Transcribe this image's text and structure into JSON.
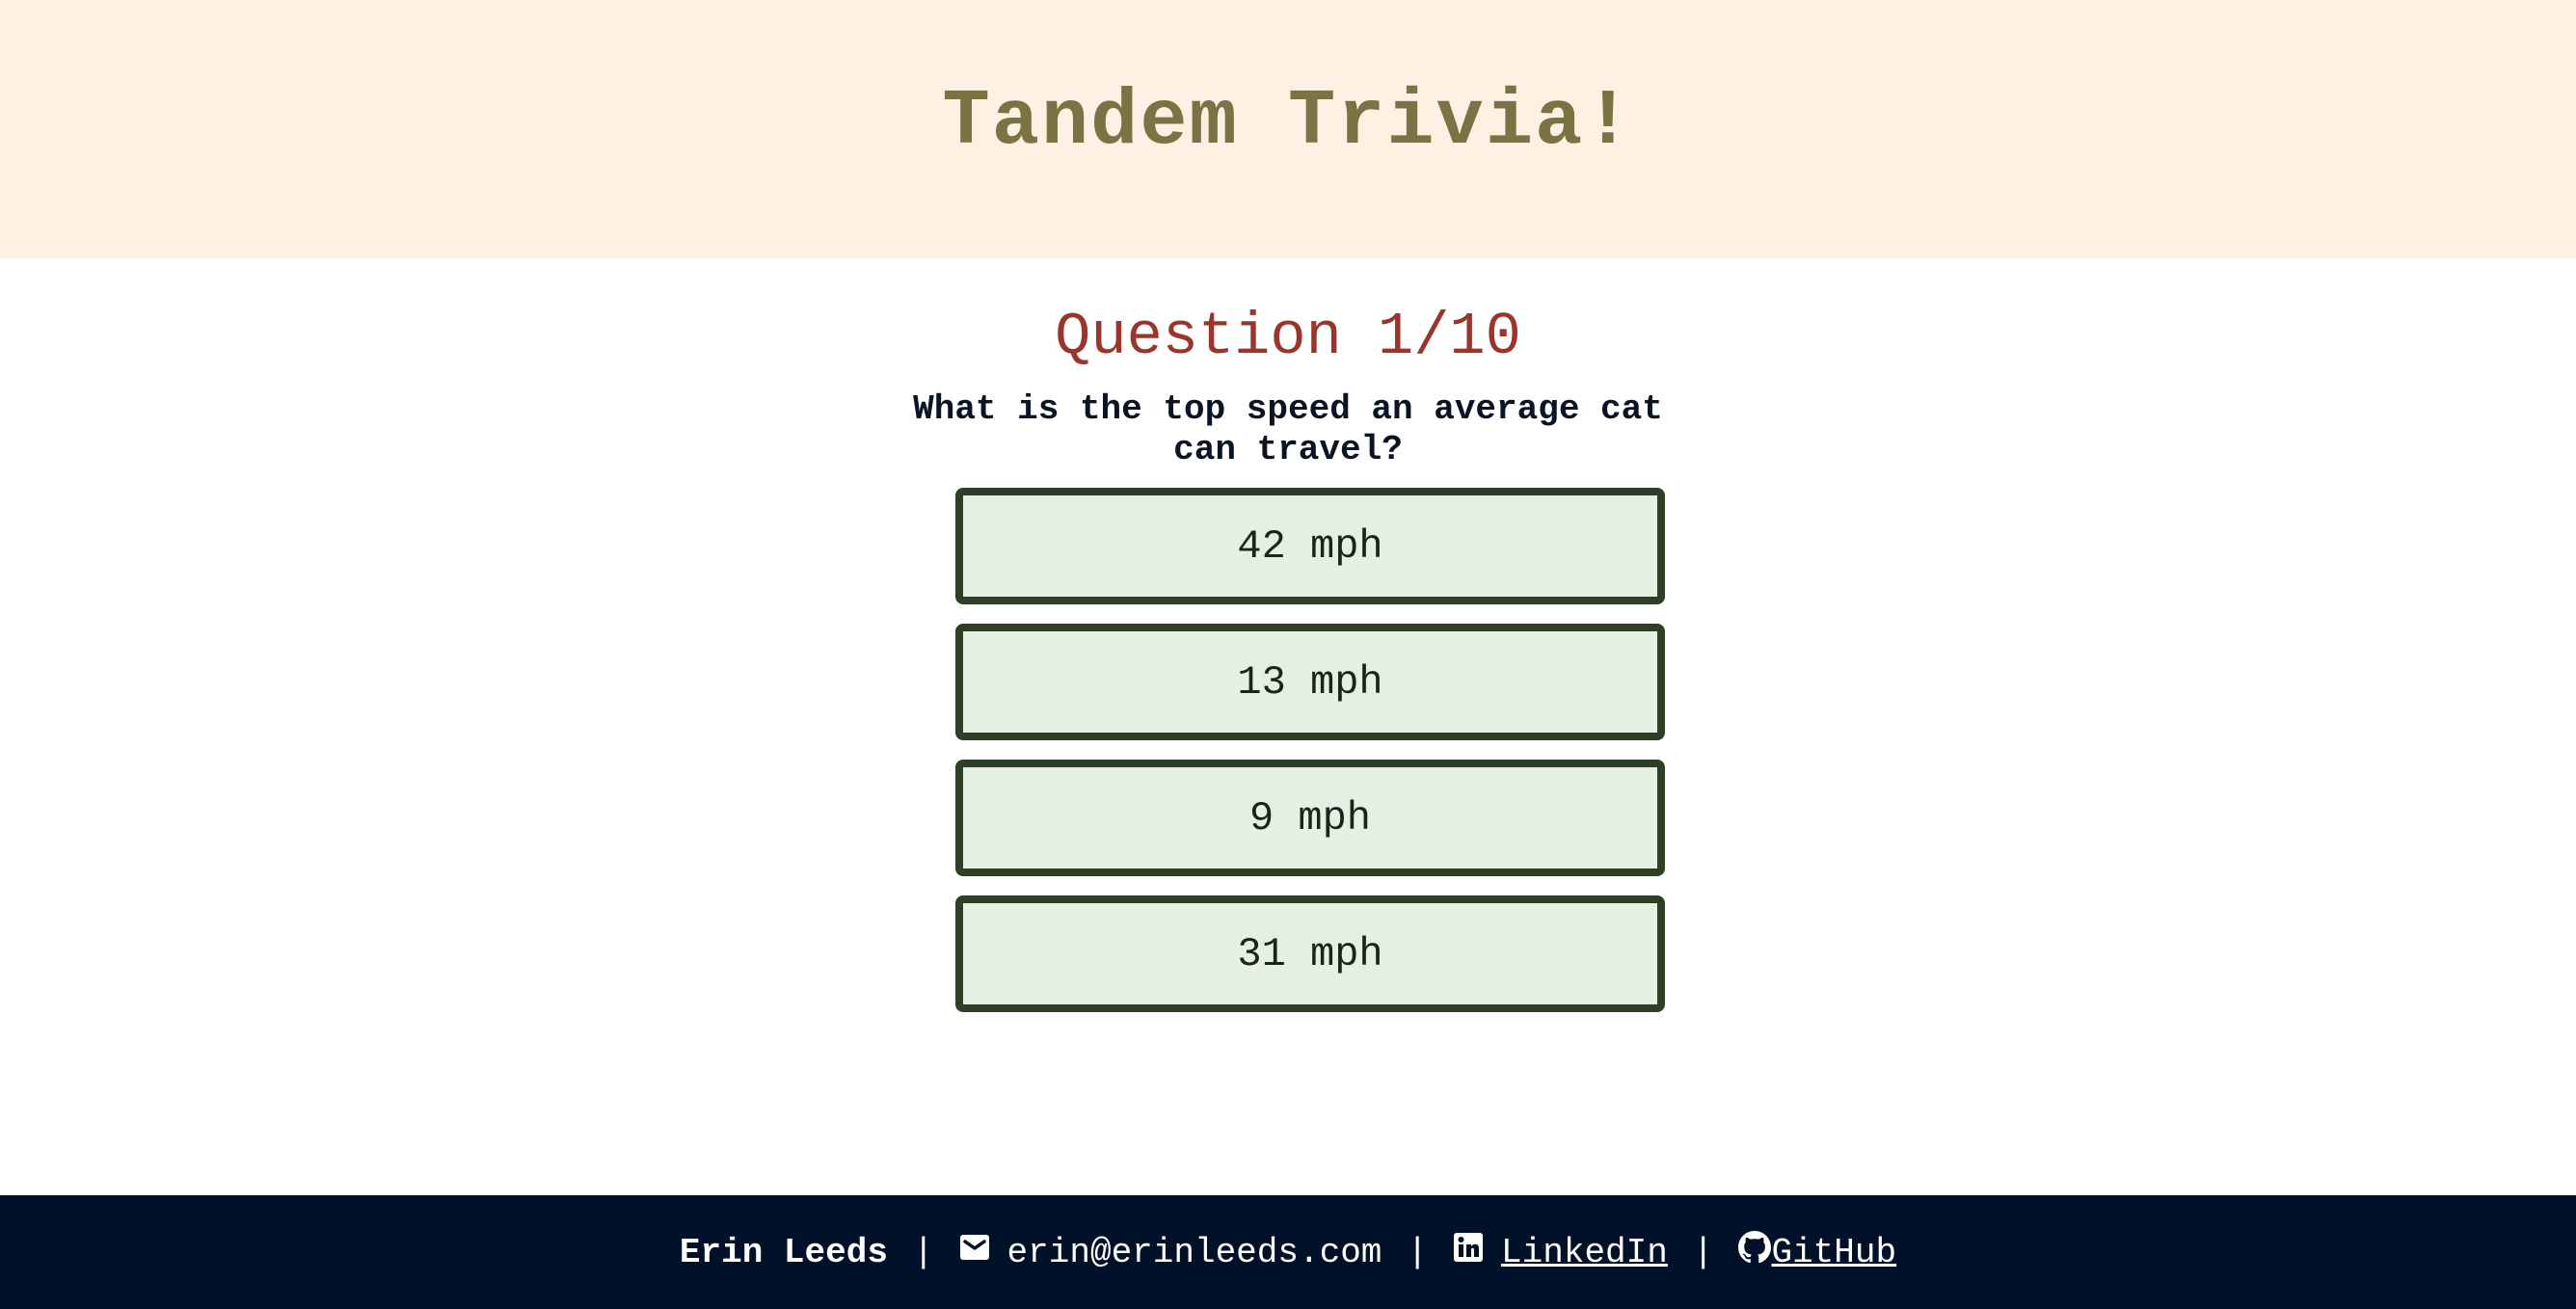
{
  "header": {
    "title": "Tandem Trivia!"
  },
  "quiz": {
    "counter": "Question 1/10",
    "question": "What is the top speed an average cat can travel?",
    "answers": [
      {
        "label": "42 mph"
      },
      {
        "label": "13 mph"
      },
      {
        "label": "9 mph"
      },
      {
        "label": "31 mph"
      }
    ]
  },
  "footer": {
    "name": "Erin Leeds",
    "separator": "|",
    "email": "erin@erinleeds.com",
    "linkedin": "LinkedIn ",
    "github": " GitHub",
    "icons": [
      "mail-icon",
      "linkedin-icon",
      "github-icon"
    ]
  },
  "colors": {
    "header_bg": "#fdf1e3",
    "title": "#7a7444",
    "counter": "#9a352b",
    "answer_bg": "#e5f0e3",
    "answer_border": "#2f3f27",
    "footer_bg": "#01112a"
  }
}
